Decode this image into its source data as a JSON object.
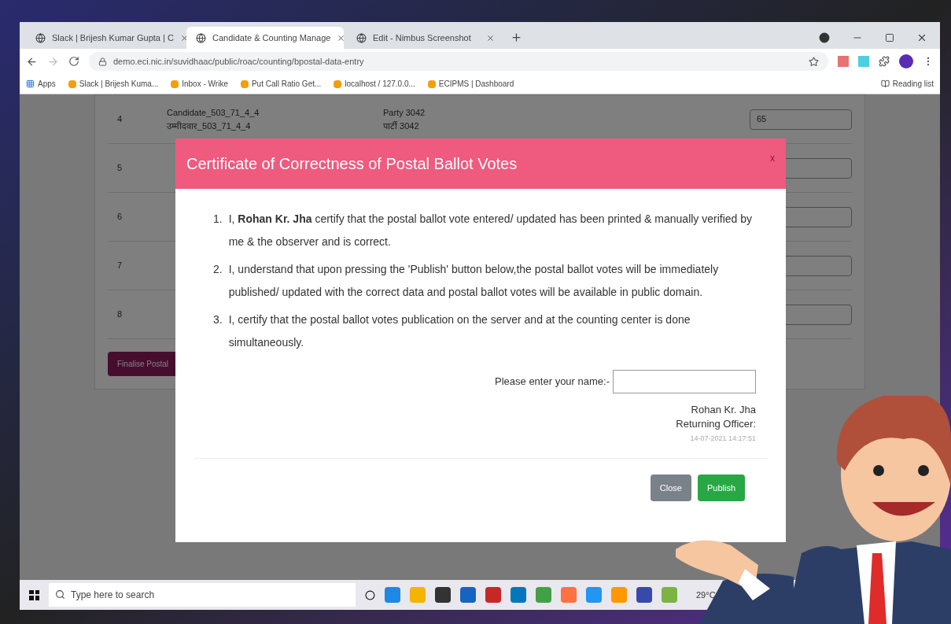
{
  "browser": {
    "tabs": [
      {
        "label": "Slack | Brijesh Kumar Gupta | C",
        "selected": false
      },
      {
        "label": "Candidate & Counting Manage",
        "selected": true
      },
      {
        "label": "Edit - Nimbus Screenshot",
        "selected": false
      }
    ],
    "url": "demo.eci.nic.in/suvidhaac/public/roac/counting/bpostal-data-entry",
    "bookmarks": [
      "Apps",
      "Slack | Brijesh Kuma...",
      "Inbox - Wrike",
      "Put Call Ratio Get...",
      "localhost / 127.0.0...",
      "ECIPMS | Dashboard"
    ],
    "reading_list": "Reading list"
  },
  "table": {
    "rows": [
      {
        "number": "4",
        "candidate": "Candidate_503_71_4_4",
        "candidate_hindi": "उम्मीदवार_503_71_4_4",
        "party": "Party 3042",
        "party_hindi": "पार्टी 3042",
        "votes": "65"
      },
      {
        "number": "5",
        "votes": ""
      },
      {
        "number": "6",
        "votes": ""
      },
      {
        "number": "7",
        "votes": ""
      },
      {
        "number": "8",
        "votes": ""
      }
    ],
    "finalise_button": "Finalise Postal"
  },
  "modal": {
    "title": "Certificate of Correctness of Postal Ballot Votes",
    "close": "x",
    "items": [
      {
        "number": "1.",
        "text": "I, **Rohan Kr. Jha** certify that the postal ballot vote entered/ updated has been printed & manually verified by me & the observer and is correct."
      },
      {
        "number": "2.",
        "text": "I, understand that upon pressing the 'Publish' button below,the postal ballot votes will be immediately published/ updated with the correct data and postal ballot votes will be available in public domain."
      },
      {
        "number": "3.",
        "text": "I, certify that the postal ballot votes publication on the server and at the counting center is done simultaneously."
      }
    ],
    "name_label": "Please enter your name:-",
    "signature": {
      "name": "Rohan Kr. Jha",
      "role": "Returning Officer:",
      "timestamp": "14-07-2021 14:17:51"
    },
    "buttons": [
      {
        "label": "Close",
        "kind": "secondary"
      },
      {
        "label": "Publish",
        "kind": "primary"
      }
    ]
  },
  "taskbar": {
    "search_placeholder": "Type here to search",
    "weather": "29°C"
  }
}
